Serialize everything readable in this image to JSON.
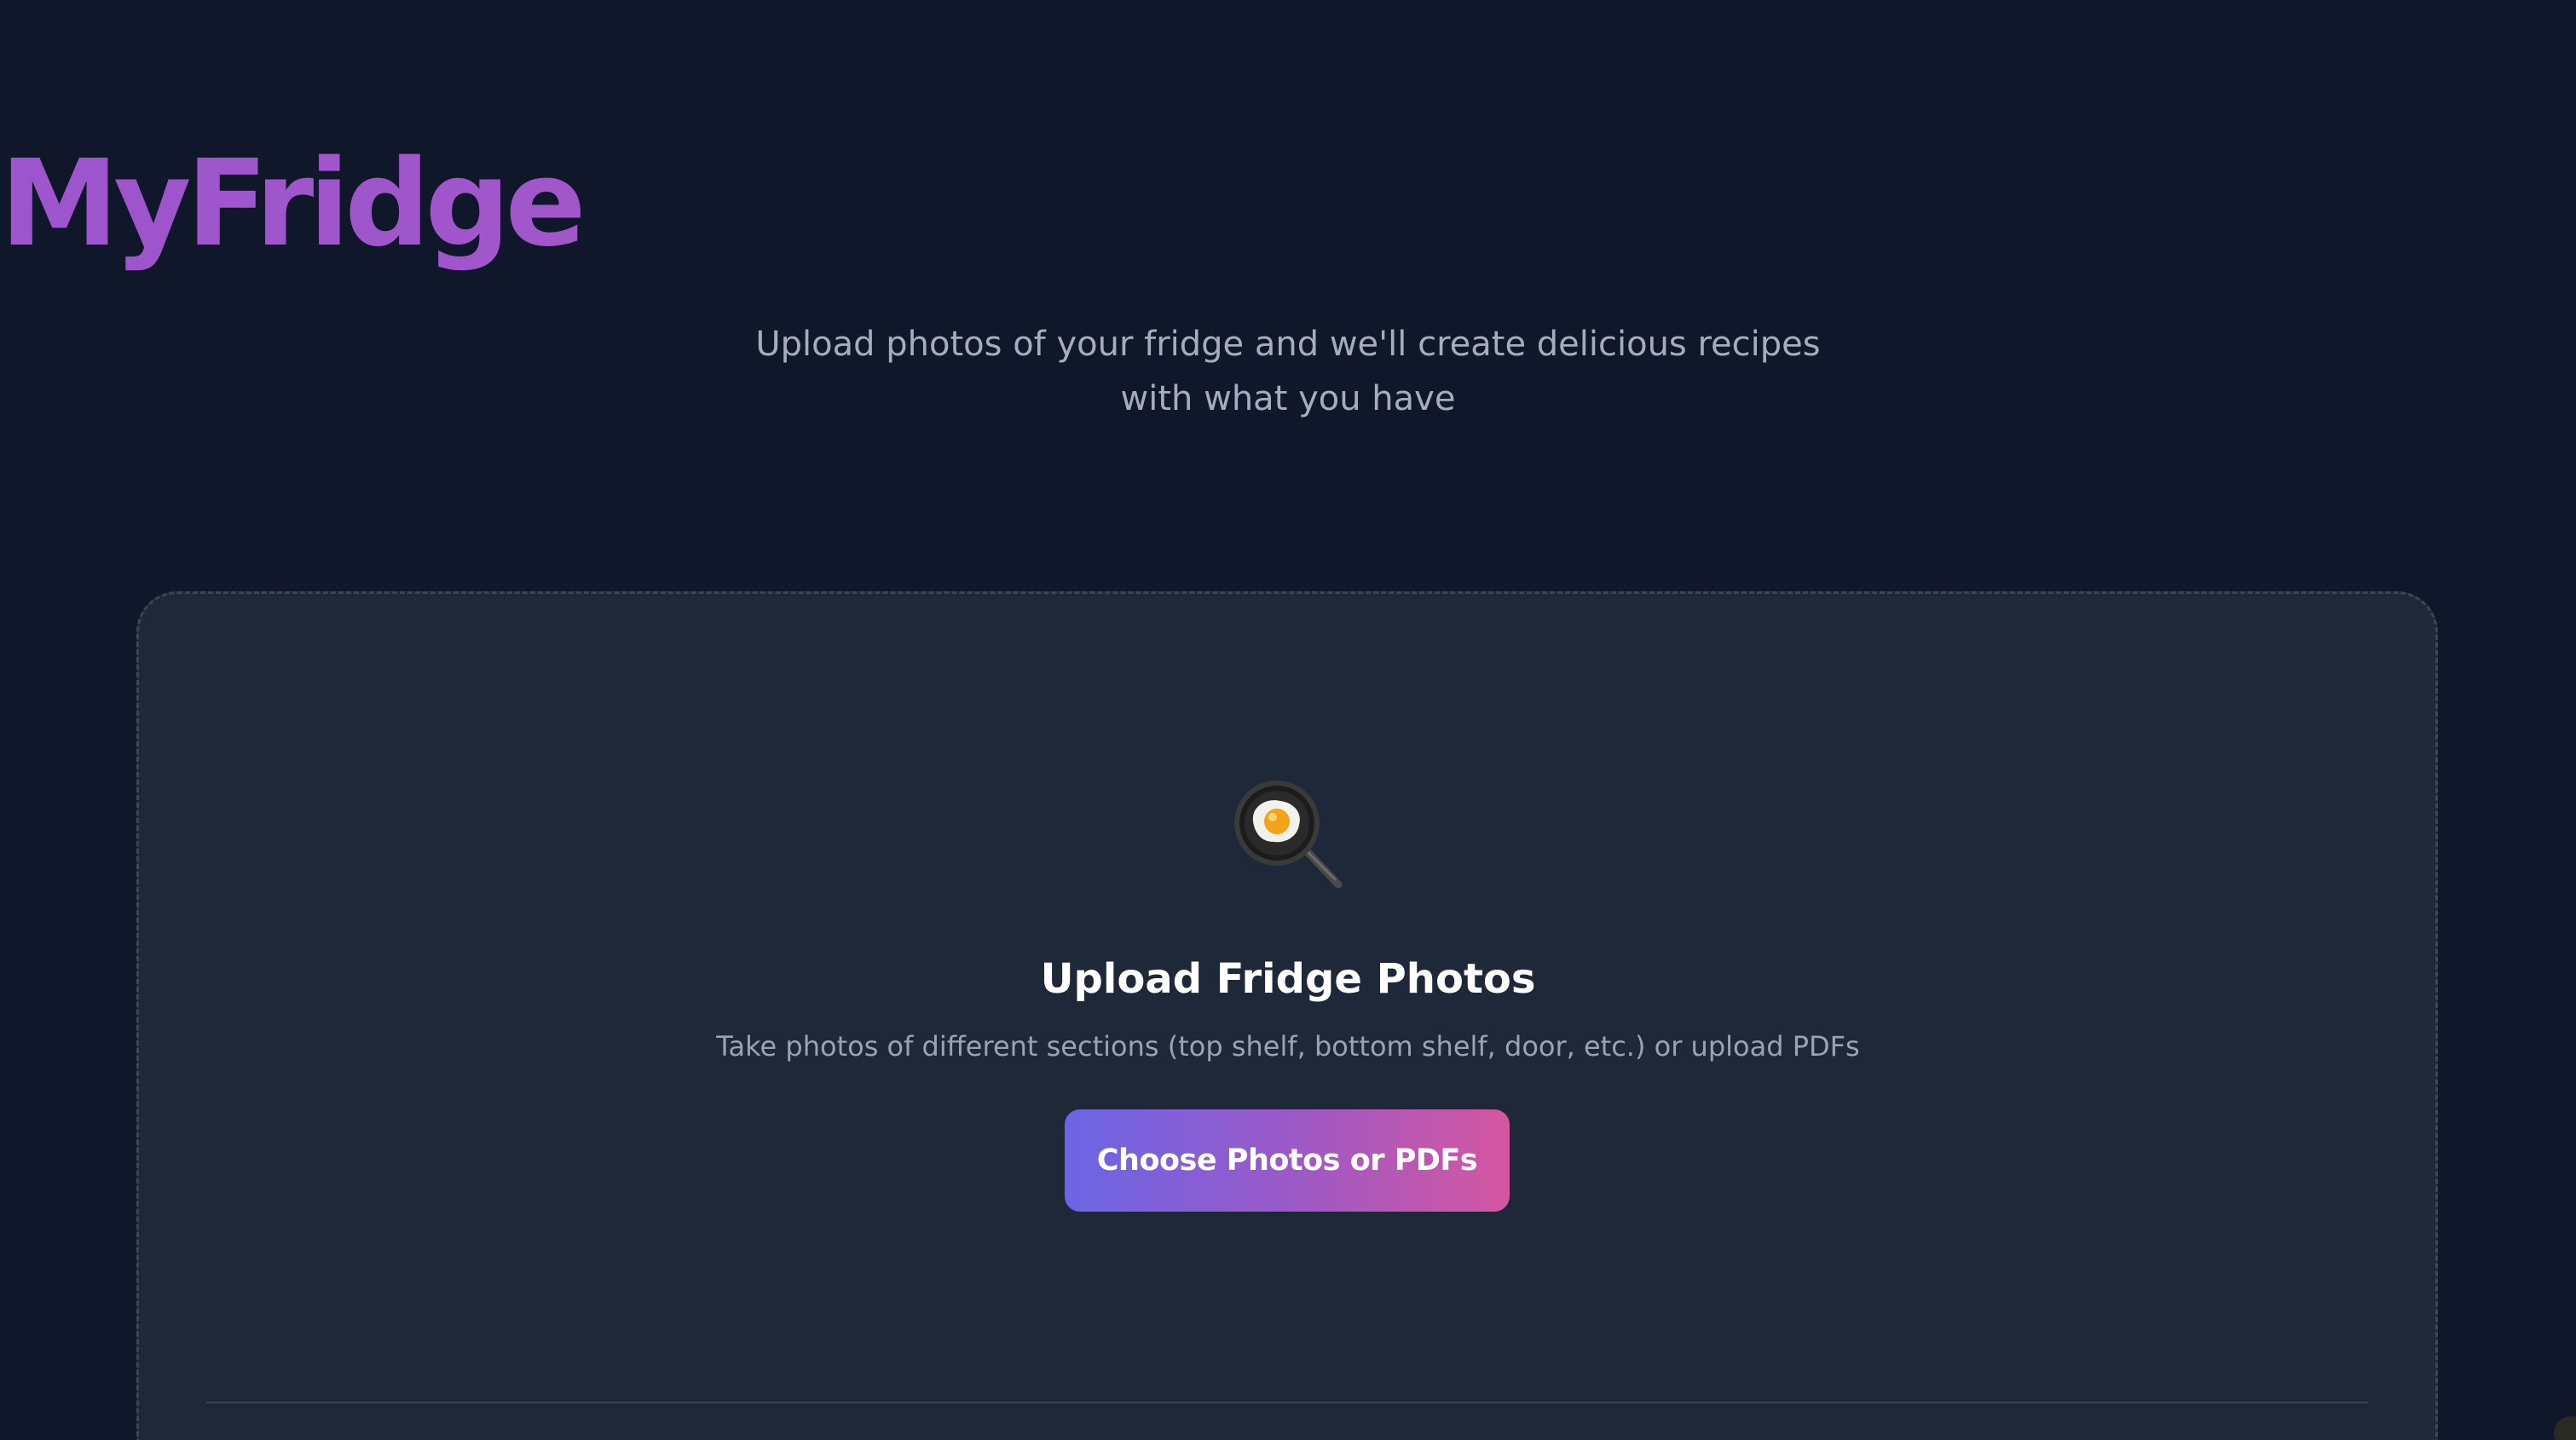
{
  "header": {
    "title": "MyFridge",
    "tagline_line1": "Upload photos of your fridge and we'll create delicious recipes",
    "tagline_line2": "with what you have"
  },
  "upload_card": {
    "icon": "frying-pan-egg-icon",
    "title": "Upload Fridge Photos",
    "description": "Take photos of different sections (top shelf, bottom shelf, door, etc.) or upload PDFs",
    "button_label": "Choose Photos or PDFs"
  },
  "colors": {
    "background": "#11172a",
    "card_background": "#1f2839",
    "title_accent": "#a356c7",
    "button_gradient_start": "#6b65e6",
    "button_gradient_end": "#d556a0"
  }
}
